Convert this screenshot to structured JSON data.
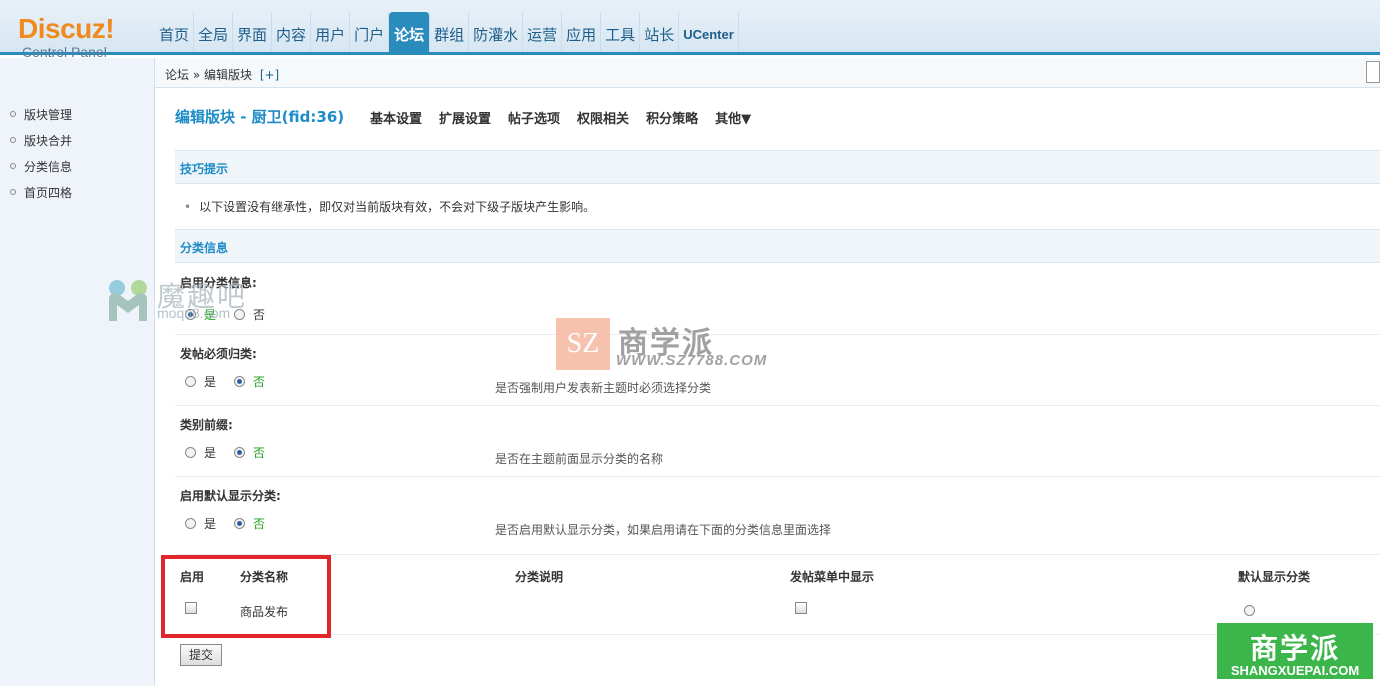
{
  "logo": {
    "brand": "Discuz!",
    "subtitle": "Control Panel"
  },
  "topnav": [
    {
      "label": "首页"
    },
    {
      "label": "全局"
    },
    {
      "label": "界面"
    },
    {
      "label": "内容"
    },
    {
      "label": "用户"
    },
    {
      "label": "门户"
    },
    {
      "label": "论坛",
      "active": true
    },
    {
      "label": "群组"
    },
    {
      "label": "防灌水"
    },
    {
      "label": "运营"
    },
    {
      "label": "应用"
    },
    {
      "label": "工具"
    },
    {
      "label": "站长"
    },
    {
      "label": "UCenter"
    }
  ],
  "breadcrumb": {
    "text": "论坛 » 编辑版块",
    "add": "[+]"
  },
  "sidebar": {
    "items": [
      "版块管理",
      "版块合并",
      "分类信息",
      "首页四格"
    ]
  },
  "page": {
    "title": "编辑版块 - 厨卫(fid:36)",
    "subnav": [
      "基本设置",
      "扩展设置",
      "帖子选项",
      "权限相关",
      "积分策略",
      "其他▼"
    ]
  },
  "tips": {
    "header": "技巧提示",
    "text": "以下设置没有继承性，即仅对当前版块有效，不会对下级子版块产生影响。"
  },
  "typeinfo": {
    "header": "分类信息",
    "settings": [
      {
        "label": "启用分类信息:",
        "yes": "是",
        "no": "否",
        "selected": "yes",
        "desc": ""
      },
      {
        "label": "发帖必须归类:",
        "yes": "是",
        "no": "否",
        "selected": "no",
        "desc": "是否强制用户发表新主题时必须选择分类"
      },
      {
        "label": "类别前缀:",
        "yes": "是",
        "no": "否",
        "selected": "no",
        "desc": "是否在主题前面显示分类的名称"
      },
      {
        "label": "启用默认显示分类:",
        "yes": "是",
        "no": "否",
        "selected": "no",
        "desc": "是否启用默认显示分类，如果启用请在下面的分类信息里面选择"
      }
    ]
  },
  "table": {
    "headers": {
      "enable": "启用",
      "name": "分类名称",
      "desc": "分类说明",
      "show_in_menu": "发帖菜单中显示",
      "default": "默认显示分类"
    },
    "rows": [
      {
        "name": "商品发布",
        "enabled": false,
        "show_in_menu": false,
        "default": false
      }
    ]
  },
  "submit_label": "提交",
  "watermarks": {
    "moqu_title": "魔趣吧",
    "moqu_url": "moqu8.com",
    "sz_box": "SZ",
    "sz_name": "商学派",
    "sz_url": "WWW.SZ7788.COM",
    "sxp_name": "商学派",
    "sxp_url": "SHANGXUEPAI.COM"
  }
}
